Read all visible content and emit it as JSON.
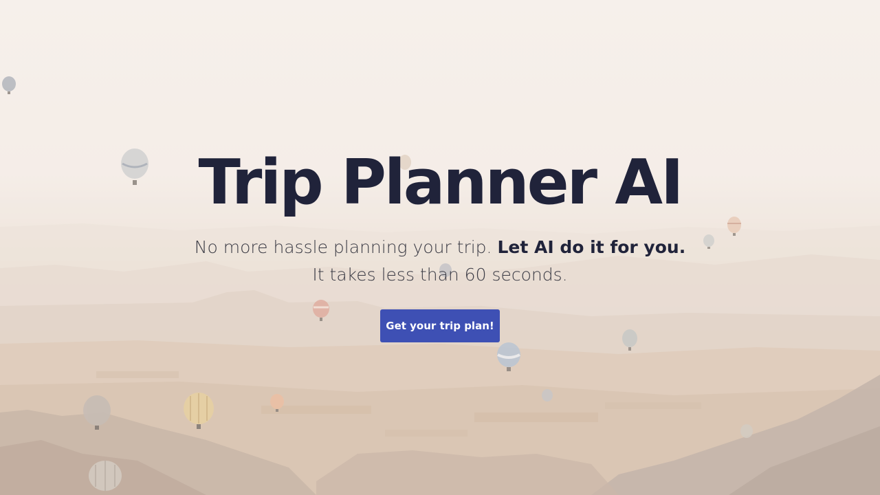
{
  "hero": {
    "title": "Trip Planner AI",
    "subtitle_part1": "No more hassle planning your trip. ",
    "subtitle_emphasis": "Let AI do it for you.",
    "subtitle_line2": "It takes less than 60 seconds.",
    "cta_label": "Get your trip plan!"
  },
  "colors": {
    "title": "#20233a",
    "cta_background": "#3e50b4",
    "cta_text": "#ffffff"
  },
  "background": {
    "image_subject": "hot-air-balloons-over-valley"
  }
}
